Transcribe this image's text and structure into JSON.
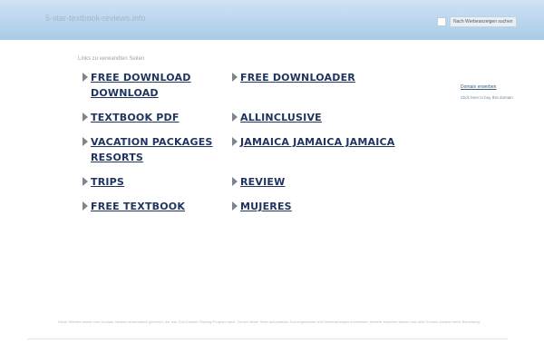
{
  "header": {
    "site_title": "5-star-textbook-reviews.info",
    "search_button": "Nach Werbeanzeigen suchen"
  },
  "links": {
    "heading": "Links zu verwandten Seiten",
    "items": [
      {
        "label": "FREE DOWNLOAD DOWNLOAD"
      },
      {
        "label": "FREE DOWNLOADER"
      },
      {
        "label": "TEXTBOOK PDF"
      },
      {
        "label": "ALLINCLUSIVE"
      },
      {
        "label": "VACATION PACKAGES RESORTS"
      },
      {
        "label": "JAMAICA JAMAICA JAMAICA"
      },
      {
        "label": "TRIPS"
      },
      {
        "label": "REVIEW"
      },
      {
        "label": "FREE TEXTBOOK"
      },
      {
        "label": "MUJERES"
      }
    ]
  },
  "sidebar": {
    "domain_link": "Domain erwerben",
    "domain_sub": "Click here to buy this domain"
  },
  "footer": {
    "text": "Diese Website wurde vom Domain-Inhaber automatisch generiert, der das Tool Domain Parking Program nutzt. Da auf dieser Seite automatisch Suchergebnisse und Werbeanzeigen erscheinen, besteht zwischen diesen und dem Domain-Inhaber keine Beziehung."
  }
}
